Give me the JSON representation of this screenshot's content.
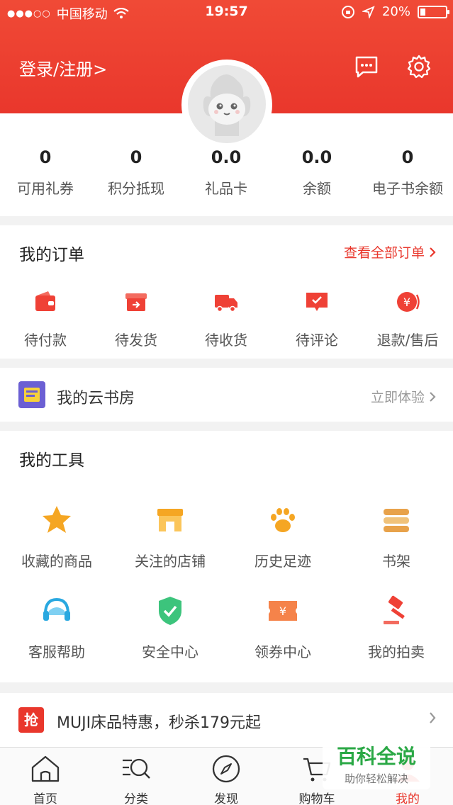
{
  "status_bar": {
    "carrier": "中国移动",
    "time": "19:57",
    "battery": "20%"
  },
  "header": {
    "login_label": "登录/注册>"
  },
  "stats": [
    {
      "value": "0",
      "label": "可用礼券"
    },
    {
      "value": "0",
      "label": "积分抵现"
    },
    {
      "value": "0.0",
      "label": "礼品卡"
    },
    {
      "value": "0.0",
      "label": "余额"
    },
    {
      "value": "0",
      "label": "电子书余额"
    }
  ],
  "orders": {
    "title": "我的订单",
    "view_all": "查看全部订单",
    "items": [
      {
        "label": "待付款",
        "icon": "wallet-icon"
      },
      {
        "label": "待发货",
        "icon": "box-icon"
      },
      {
        "label": "待收货",
        "icon": "truck-icon"
      },
      {
        "label": "待评论",
        "icon": "comment-icon"
      },
      {
        "label": "退款/售后",
        "icon": "refund-icon"
      }
    ]
  },
  "cloud_study": {
    "label": "我的云书房",
    "action": "立即体验"
  },
  "tools": {
    "title": "我的工具",
    "items": [
      {
        "label": "收藏的商品",
        "icon": "star-icon"
      },
      {
        "label": "关注的店铺",
        "icon": "store-icon"
      },
      {
        "label": "历史足迹",
        "icon": "paw-icon"
      },
      {
        "label": "书架",
        "icon": "bookshelf-icon"
      },
      {
        "label": "客服帮助",
        "icon": "headset-icon"
      },
      {
        "label": "安全中心",
        "icon": "shield-icon"
      },
      {
        "label": "领券中心",
        "icon": "coupon-icon"
      },
      {
        "label": "我的拍卖",
        "icon": "gavel-icon"
      }
    ]
  },
  "promo": {
    "badge": "抢",
    "text": "MUJI床品特惠，秒杀179元起"
  },
  "tabbar": [
    {
      "label": "首页",
      "icon": "home-icon"
    },
    {
      "label": "分类",
      "icon": "category-icon"
    },
    {
      "label": "发现",
      "icon": "compass-icon"
    },
    {
      "label": "购物车",
      "icon": "cart-icon"
    },
    {
      "label": "我的",
      "icon": "profile-icon",
      "active": true
    }
  ],
  "watermark": {
    "title": "百科全说",
    "subtitle": "助你轻松解决"
  },
  "colors": {
    "brand_red": "#e9372c",
    "battery_level": 0.2
  }
}
